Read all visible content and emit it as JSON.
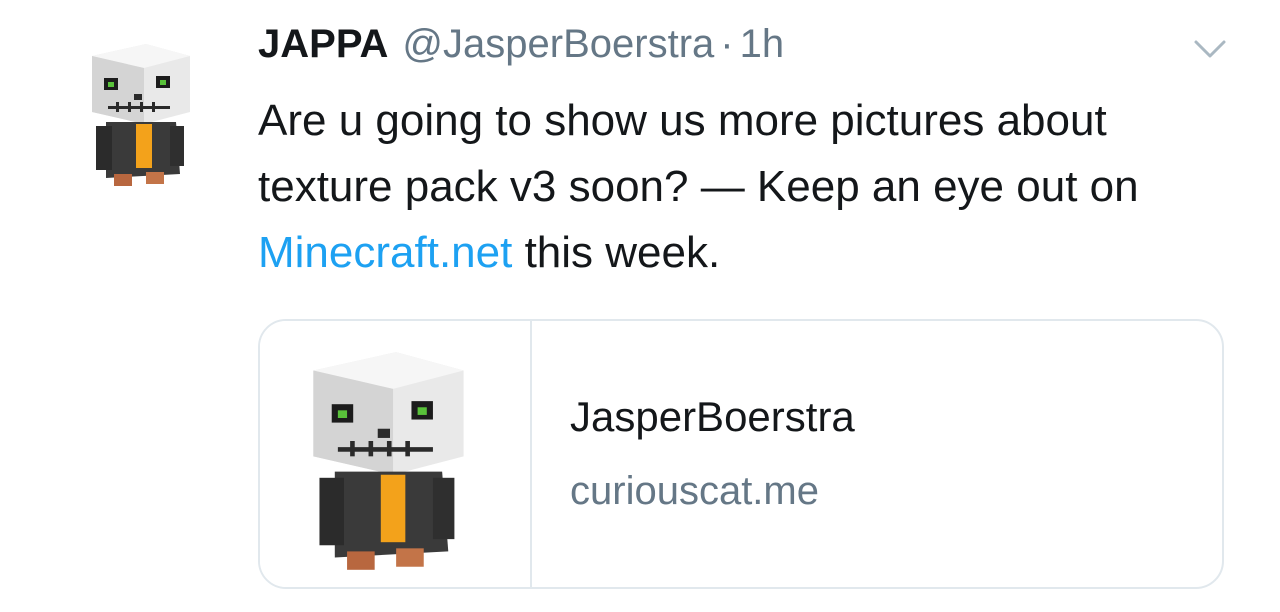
{
  "tweet": {
    "author_name": "JAPPA",
    "author_handle": "@JasperBoerstra",
    "separator": "·",
    "timestamp": "1h",
    "avatar_icon": "minecraft-skeleton-icon",
    "menu_icon": "chevron-down-icon",
    "text_part1": "Are u going to show us more pictures about texture pack v3 soon? — Keep an eye out on ",
    "link_text": "Minecraft.net",
    "text_part2": " this week."
  },
  "card": {
    "title": "JasperBoerstra",
    "domain": "curiouscat.me",
    "thumbnail_icon": "minecraft-skeleton-icon"
  },
  "colors": {
    "link": "#1da1f2",
    "secondary_text": "#657786",
    "border": "#e1e8ed"
  }
}
